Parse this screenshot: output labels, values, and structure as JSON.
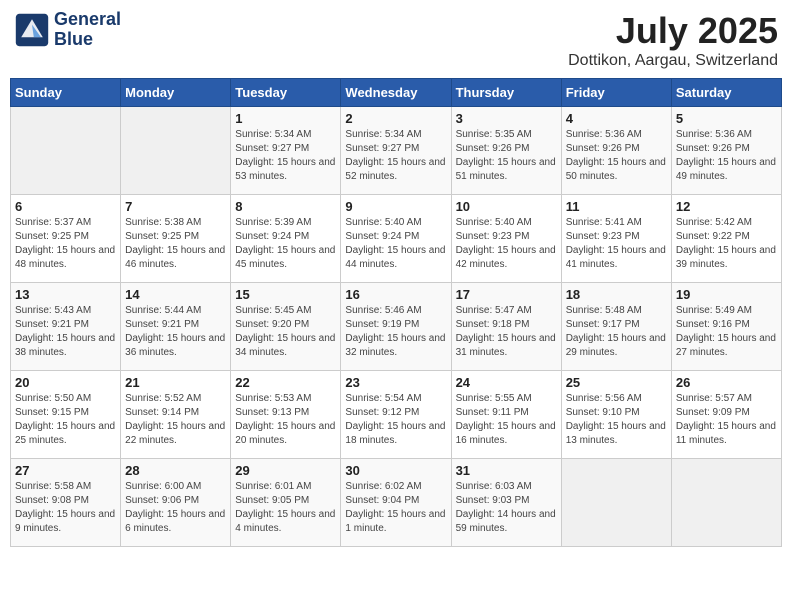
{
  "header": {
    "logo_line1": "General",
    "logo_line2": "Blue",
    "month": "July 2025",
    "location": "Dottikon, Aargau, Switzerland"
  },
  "weekdays": [
    "Sunday",
    "Monday",
    "Tuesday",
    "Wednesday",
    "Thursday",
    "Friday",
    "Saturday"
  ],
  "weeks": [
    [
      {
        "day": "",
        "sunrise": "",
        "sunset": "",
        "daylight": ""
      },
      {
        "day": "",
        "sunrise": "",
        "sunset": "",
        "daylight": ""
      },
      {
        "day": "1",
        "sunrise": "Sunrise: 5:34 AM",
        "sunset": "Sunset: 9:27 PM",
        "daylight": "Daylight: 15 hours and 53 minutes."
      },
      {
        "day": "2",
        "sunrise": "Sunrise: 5:34 AM",
        "sunset": "Sunset: 9:27 PM",
        "daylight": "Daylight: 15 hours and 52 minutes."
      },
      {
        "day": "3",
        "sunrise": "Sunrise: 5:35 AM",
        "sunset": "Sunset: 9:26 PM",
        "daylight": "Daylight: 15 hours and 51 minutes."
      },
      {
        "day": "4",
        "sunrise": "Sunrise: 5:36 AM",
        "sunset": "Sunset: 9:26 PM",
        "daylight": "Daylight: 15 hours and 50 minutes."
      },
      {
        "day": "5",
        "sunrise": "Sunrise: 5:36 AM",
        "sunset": "Sunset: 9:26 PM",
        "daylight": "Daylight: 15 hours and 49 minutes."
      }
    ],
    [
      {
        "day": "6",
        "sunrise": "Sunrise: 5:37 AM",
        "sunset": "Sunset: 9:25 PM",
        "daylight": "Daylight: 15 hours and 48 minutes."
      },
      {
        "day": "7",
        "sunrise": "Sunrise: 5:38 AM",
        "sunset": "Sunset: 9:25 PM",
        "daylight": "Daylight: 15 hours and 46 minutes."
      },
      {
        "day": "8",
        "sunrise": "Sunrise: 5:39 AM",
        "sunset": "Sunset: 9:24 PM",
        "daylight": "Daylight: 15 hours and 45 minutes."
      },
      {
        "day": "9",
        "sunrise": "Sunrise: 5:40 AM",
        "sunset": "Sunset: 9:24 PM",
        "daylight": "Daylight: 15 hours and 44 minutes."
      },
      {
        "day": "10",
        "sunrise": "Sunrise: 5:40 AM",
        "sunset": "Sunset: 9:23 PM",
        "daylight": "Daylight: 15 hours and 42 minutes."
      },
      {
        "day": "11",
        "sunrise": "Sunrise: 5:41 AM",
        "sunset": "Sunset: 9:23 PM",
        "daylight": "Daylight: 15 hours and 41 minutes."
      },
      {
        "day": "12",
        "sunrise": "Sunrise: 5:42 AM",
        "sunset": "Sunset: 9:22 PM",
        "daylight": "Daylight: 15 hours and 39 minutes."
      }
    ],
    [
      {
        "day": "13",
        "sunrise": "Sunrise: 5:43 AM",
        "sunset": "Sunset: 9:21 PM",
        "daylight": "Daylight: 15 hours and 38 minutes."
      },
      {
        "day": "14",
        "sunrise": "Sunrise: 5:44 AM",
        "sunset": "Sunset: 9:21 PM",
        "daylight": "Daylight: 15 hours and 36 minutes."
      },
      {
        "day": "15",
        "sunrise": "Sunrise: 5:45 AM",
        "sunset": "Sunset: 9:20 PM",
        "daylight": "Daylight: 15 hours and 34 minutes."
      },
      {
        "day": "16",
        "sunrise": "Sunrise: 5:46 AM",
        "sunset": "Sunset: 9:19 PM",
        "daylight": "Daylight: 15 hours and 32 minutes."
      },
      {
        "day": "17",
        "sunrise": "Sunrise: 5:47 AM",
        "sunset": "Sunset: 9:18 PM",
        "daylight": "Daylight: 15 hours and 31 minutes."
      },
      {
        "day": "18",
        "sunrise": "Sunrise: 5:48 AM",
        "sunset": "Sunset: 9:17 PM",
        "daylight": "Daylight: 15 hours and 29 minutes."
      },
      {
        "day": "19",
        "sunrise": "Sunrise: 5:49 AM",
        "sunset": "Sunset: 9:16 PM",
        "daylight": "Daylight: 15 hours and 27 minutes."
      }
    ],
    [
      {
        "day": "20",
        "sunrise": "Sunrise: 5:50 AM",
        "sunset": "Sunset: 9:15 PM",
        "daylight": "Daylight: 15 hours and 25 minutes."
      },
      {
        "day": "21",
        "sunrise": "Sunrise: 5:52 AM",
        "sunset": "Sunset: 9:14 PM",
        "daylight": "Daylight: 15 hours and 22 minutes."
      },
      {
        "day": "22",
        "sunrise": "Sunrise: 5:53 AM",
        "sunset": "Sunset: 9:13 PM",
        "daylight": "Daylight: 15 hours and 20 minutes."
      },
      {
        "day": "23",
        "sunrise": "Sunrise: 5:54 AM",
        "sunset": "Sunset: 9:12 PM",
        "daylight": "Daylight: 15 hours and 18 minutes."
      },
      {
        "day": "24",
        "sunrise": "Sunrise: 5:55 AM",
        "sunset": "Sunset: 9:11 PM",
        "daylight": "Daylight: 15 hours and 16 minutes."
      },
      {
        "day": "25",
        "sunrise": "Sunrise: 5:56 AM",
        "sunset": "Sunset: 9:10 PM",
        "daylight": "Daylight: 15 hours and 13 minutes."
      },
      {
        "day": "26",
        "sunrise": "Sunrise: 5:57 AM",
        "sunset": "Sunset: 9:09 PM",
        "daylight": "Daylight: 15 hours and 11 minutes."
      }
    ],
    [
      {
        "day": "27",
        "sunrise": "Sunrise: 5:58 AM",
        "sunset": "Sunset: 9:08 PM",
        "daylight": "Daylight: 15 hours and 9 minutes."
      },
      {
        "day": "28",
        "sunrise": "Sunrise: 6:00 AM",
        "sunset": "Sunset: 9:06 PM",
        "daylight": "Daylight: 15 hours and 6 minutes."
      },
      {
        "day": "29",
        "sunrise": "Sunrise: 6:01 AM",
        "sunset": "Sunset: 9:05 PM",
        "daylight": "Daylight: 15 hours and 4 minutes."
      },
      {
        "day": "30",
        "sunrise": "Sunrise: 6:02 AM",
        "sunset": "Sunset: 9:04 PM",
        "daylight": "Daylight: 15 hours and 1 minute."
      },
      {
        "day": "31",
        "sunrise": "Sunrise: 6:03 AM",
        "sunset": "Sunset: 9:03 PM",
        "daylight": "Daylight: 14 hours and 59 minutes."
      },
      {
        "day": "",
        "sunrise": "",
        "sunset": "",
        "daylight": ""
      },
      {
        "day": "",
        "sunrise": "",
        "sunset": "",
        "daylight": ""
      }
    ]
  ]
}
